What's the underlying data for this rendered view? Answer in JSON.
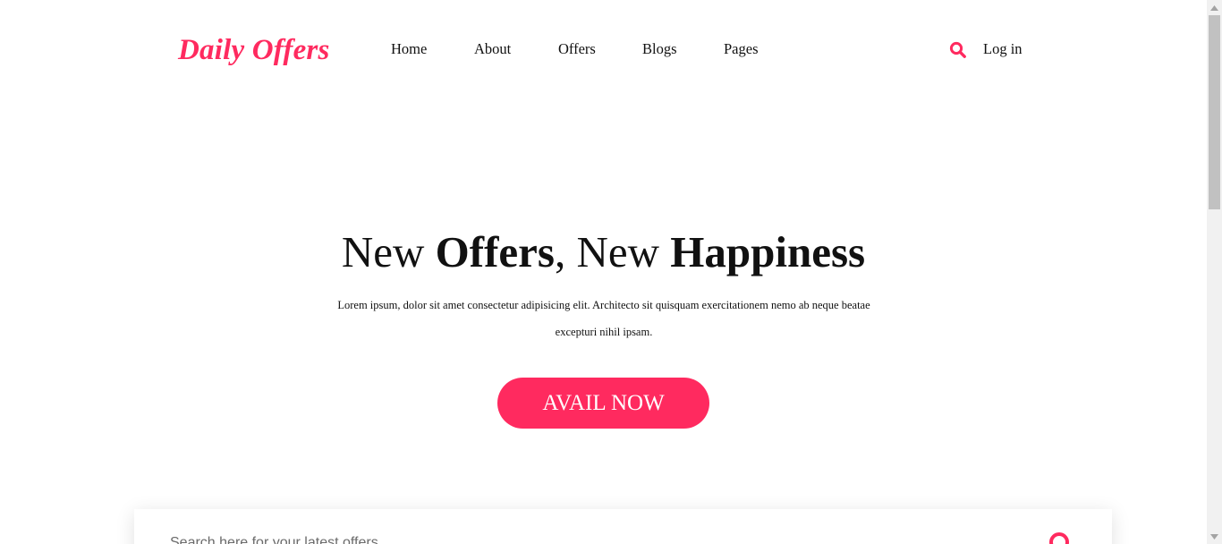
{
  "brand": {
    "name": "Daily Offers",
    "accent_color": "#ff2a5f"
  },
  "nav": {
    "items": [
      {
        "label": "Home"
      },
      {
        "label": "About"
      },
      {
        "label": "Offers"
      },
      {
        "label": "Blogs"
      },
      {
        "label": "Pages"
      }
    ],
    "search_icon": "search-icon",
    "login_label": "Log in"
  },
  "hero": {
    "title_part1": "New ",
    "title_bold1": "Offers",
    "title_part2": ", New ",
    "title_bold2": "Happiness",
    "text": "Lorem ipsum, dolor sit amet consectetur adipisicing elit. Architecto sit quisquam exercitationem nemo ab neque beatae excepturi nihil ipsam.",
    "cta_label": "AVAIL NOW"
  },
  "search": {
    "placeholder": "Search here for your latest offers",
    "button_icon": "search-icon"
  }
}
